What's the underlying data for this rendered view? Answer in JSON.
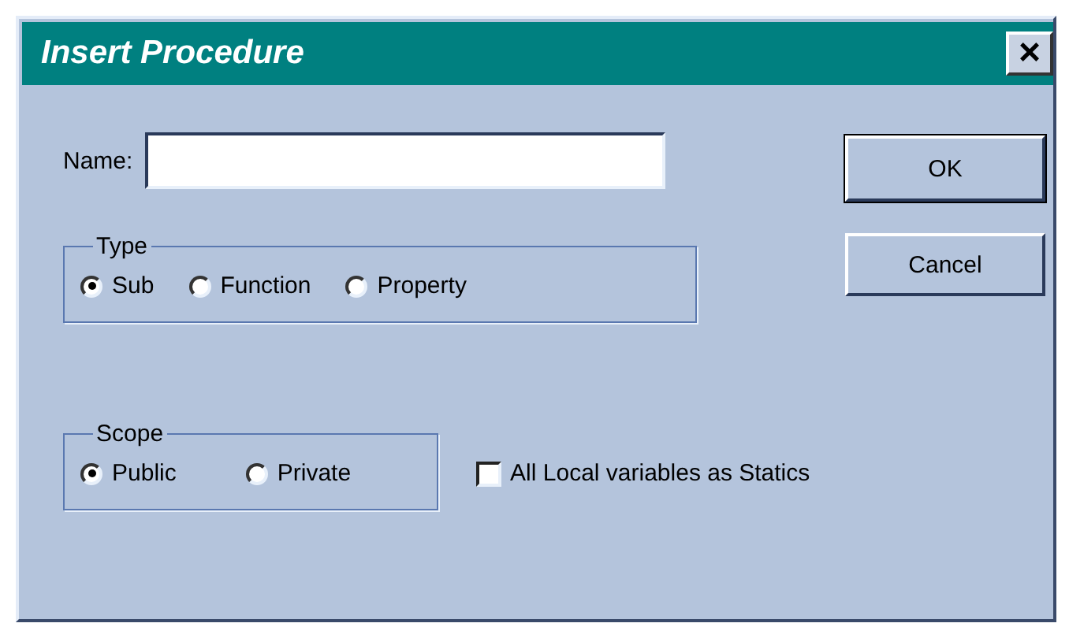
{
  "window": {
    "title": "Insert Procedure",
    "close": "×"
  },
  "name_field": {
    "label": "Name:"
  },
  "type_group": {
    "title": "Type",
    "options": [
      {
        "label": "Sub",
        "selected": true
      },
      {
        "label": "Function",
        "selected": false
      },
      {
        "label": "Property",
        "selected": false
      }
    ]
  },
  "scope_group": {
    "title": "Scope",
    "options": [
      {
        "label": "Public",
        "selected": true
      },
      {
        "label": "Private",
        "selected": false
      }
    ]
  },
  "statics_checkbox": {
    "label": "All Local variables as Statics",
    "checked": false
  },
  "buttons": [
    {
      "label": "OK",
      "default": true
    },
    {
      "label": "Cancel",
      "default": false
    }
  ]
}
